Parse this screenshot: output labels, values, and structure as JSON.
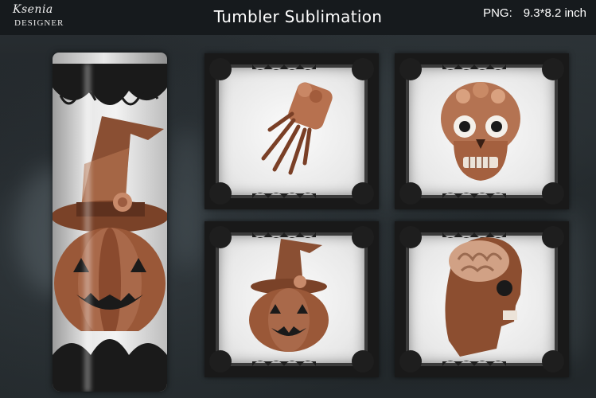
{
  "brand": {
    "script": "Ksenia",
    "caps": "DESIGNER"
  },
  "title": "Tumbler Sublimation",
  "spec": {
    "format": "PNG:",
    "size": "9.3*8.2 inch"
  },
  "colors": {
    "lace": "#191919",
    "copper": "#9a5a3a",
    "background": "#1c2024"
  },
  "images": [
    {
      "subject": "lace-hand-icon"
    },
    {
      "subject": "sugar-skull-icon"
    },
    {
      "subject": "witch-pumpkin-icon"
    },
    {
      "subject": "skull-profile-brain-icon"
    }
  ]
}
